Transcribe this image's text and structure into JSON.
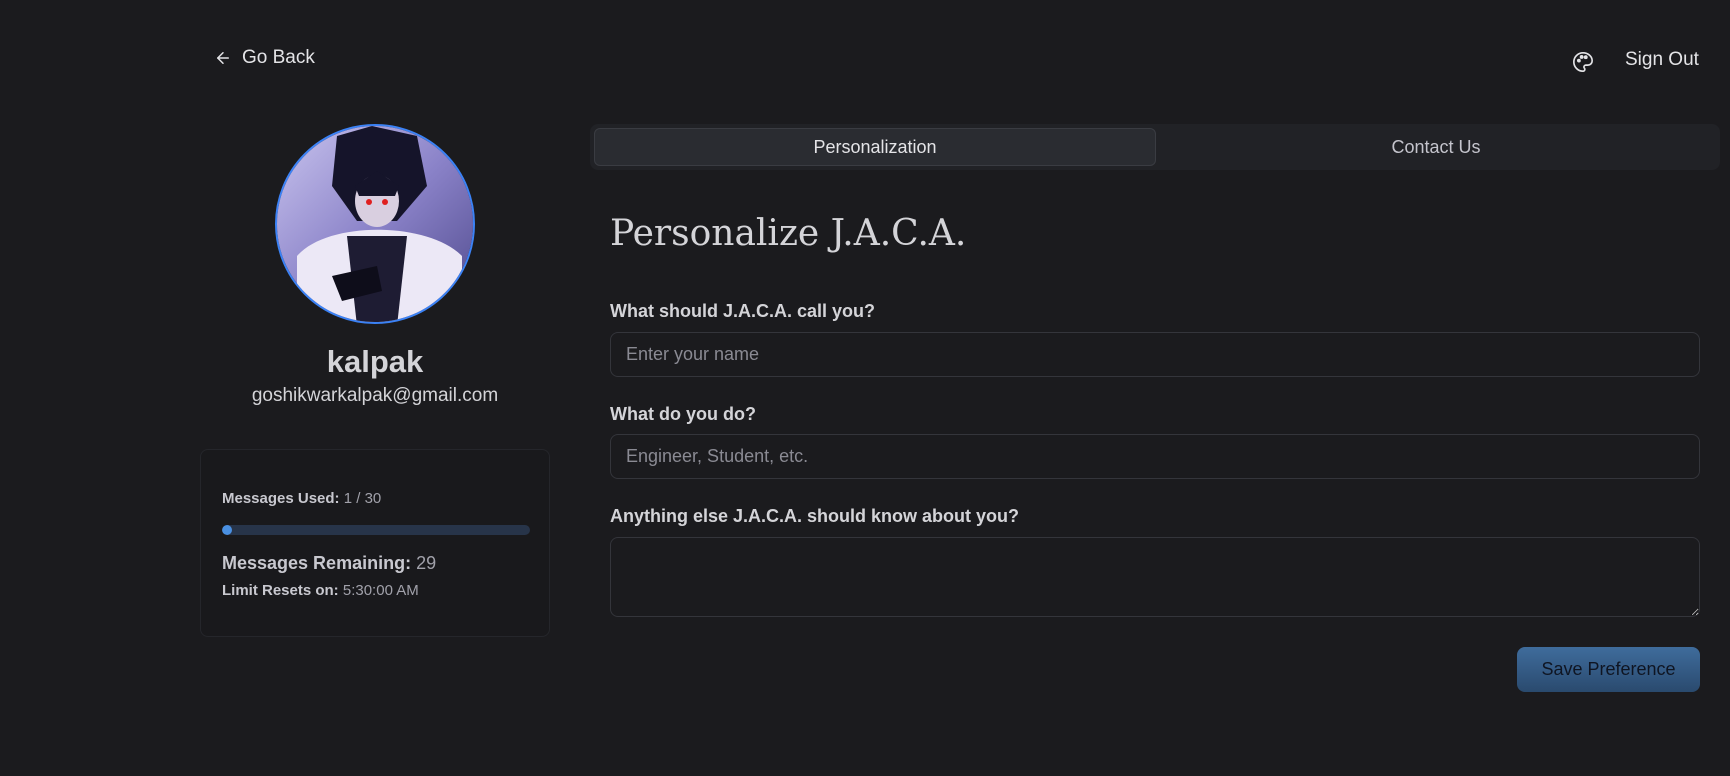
{
  "header": {
    "go_back_label": "Go Back",
    "theme_icon": "palette-icon",
    "sign_out_label": "Sign Out"
  },
  "profile": {
    "username": "kalpak",
    "email": "goshikwarkalpak@gmail.com"
  },
  "usage": {
    "used_label": "Messages Used:",
    "used_value": "1 / 30",
    "progress_fraction": 0.033,
    "remaining_label": "Messages Remaining:",
    "remaining_value": "29",
    "resets_label": "Limit Resets on:",
    "resets_value": "5:30:00 AM"
  },
  "tabs": [
    {
      "label": "Personalization",
      "active": true
    },
    {
      "label": "Contact Us",
      "active": false
    }
  ],
  "form": {
    "title": "Personalize J.A.C.A.",
    "name_label": "What should J.A.C.A. call you?",
    "name_placeholder": "Enter your name",
    "name_value": "",
    "occupation_label": "What do you do?",
    "occupation_placeholder": "Engineer, Student, etc.",
    "occupation_value": "",
    "about_label": "Anything else J.A.C.A. should know about you?",
    "about_value": "",
    "save_label": "Save Preference"
  },
  "colors": {
    "background": "#1b1b1e",
    "accent": "#4a90e2",
    "save_button": "#3f6c9c"
  }
}
